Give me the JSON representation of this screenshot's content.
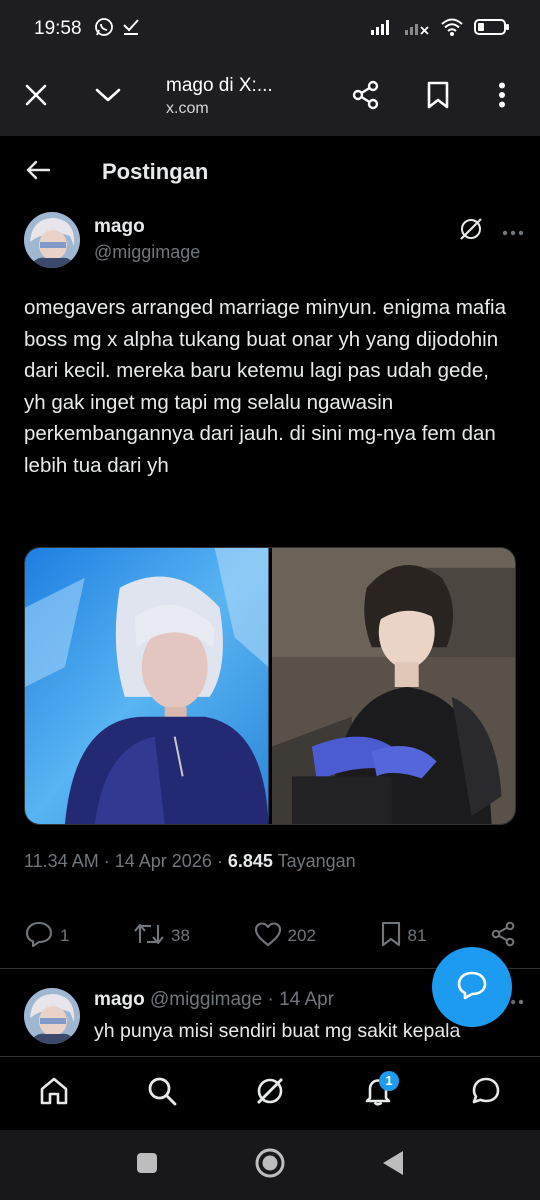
{
  "status_bar": {
    "time": "19:58",
    "icons": [
      "whatsapp-icon",
      "download-done-icon",
      "signal-icon",
      "signal-no-sim-icon",
      "wifi-icon",
      "battery-icon"
    ]
  },
  "browser": {
    "title": "mago di X:...",
    "url": "x.com"
  },
  "header": {
    "title": "Postingan"
  },
  "post": {
    "author_name": "mago",
    "author_handle": "@miggimage",
    "text": "omegavers arranged marriage minyun. enigma mafia boss mg x alpha tukang buat onar yh yang dijodohin dari kecil. mereka baru ketemu lagi pas udah gede, yh gak inget mg tapi mg selalu ngawasin perkembangannya dari jauh. di sini mg-nya fem dan lebih tua dari yh",
    "time": "11.34 AM",
    "date": "14 Apr 2026",
    "views": "6.845",
    "views_label": "Tayangan",
    "separator": "·",
    "actions": {
      "replies": "1",
      "reposts": "38",
      "likes": "202",
      "bookmarks": "81"
    }
  },
  "reply": {
    "author_name": "mago",
    "author_handle": "@miggimage",
    "separator": "·",
    "date": "14 Apr",
    "text": "yh punya misi sendiri buat mg sakit kepala"
  },
  "bottom_nav": {
    "notifications_badge": "1"
  },
  "colors": {
    "accent": "#1d9bf0",
    "background": "#000000",
    "text_primary": "#e7e9ea",
    "text_secondary": "#71767b",
    "chrome_bar": "#1e1e22"
  }
}
